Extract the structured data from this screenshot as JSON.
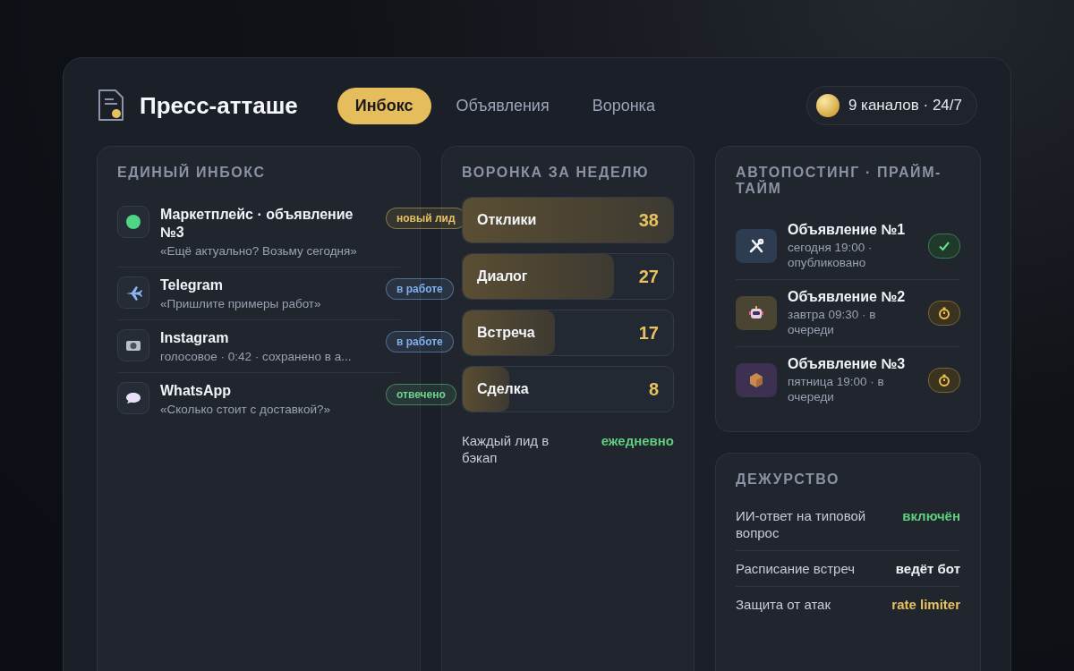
{
  "brand": {
    "title": "Пресс-атташе"
  },
  "tabs": [
    {
      "label": "Инбокс",
      "selected": true
    },
    {
      "label": "Объявления",
      "selected": false
    },
    {
      "label": "Воронка",
      "selected": false
    }
  ],
  "channels_pill": {
    "label": "9 каналов · 24/7"
  },
  "inbox": {
    "title": "ЕДИНЫЙ ИНБОКС",
    "items": [
      {
        "kind": "dot",
        "name": "Маркетплейс · объявление №3",
        "message": "«Ещё актуально? Возьму сегодня»",
        "badge": "новый лид",
        "color": "#e8c15f"
      },
      {
        "kind": "plane",
        "name": "Telegram",
        "message": "«Пришлите примеры работ»",
        "badge": "в работе",
        "color": "#7fb0ee"
      },
      {
        "kind": "camera",
        "name": "Instagram",
        "message": "голосовое · 0:42 · сохранено в а...",
        "badge": "в работе",
        "color": "#7fb0ee"
      },
      {
        "kind": "bubble",
        "name": "WhatsApp",
        "message": "«Сколько стоит с доставкой?»",
        "badge": "отвечено",
        "color": "#6fd58c"
      }
    ]
  },
  "funnel": {
    "title": "ВОРОНКА ЗА НЕДЕЛЮ",
    "bars": [
      {
        "label": "Отклики",
        "value": "38",
        "level": 1
      },
      {
        "label": "Диалог",
        "value": "27",
        "level": 0.72
      },
      {
        "label": "Встреча",
        "value": "17",
        "level": 0.44
      },
      {
        "label": "Сделка",
        "value": "8",
        "level": 0.22
      }
    ],
    "backup": {
      "label": "Каждый лид в бэкап",
      "value": "ежедневно"
    }
  },
  "autopost": {
    "title": "АВТОПОСТИНГ · ПРАЙМ-ТАЙМ",
    "items": [
      {
        "kind": "tools",
        "title": "Объявление №1",
        "subtitle": "сегодня 19:00 · опубликовано",
        "published": true
      },
      {
        "kind": "robot",
        "title": "Объявление №2",
        "subtitle": "завтра 09:30 · в очереди",
        "published": false
      },
      {
        "kind": "box",
        "title": "Объявление №3",
        "subtitle": "пятница 19:00 · в очереди",
        "published": false
      }
    ]
  },
  "duty": {
    "title": "ДЕЖУРСТВО",
    "rows": [
      {
        "label": "ИИ-ответ на типовой вопрос",
        "value": "включён",
        "color": "#5fce7e"
      },
      {
        "label": "Расписание встреч",
        "value": "ведёт бот",
        "color": "#f2f4f8"
      },
      {
        "label": "Защита от атак",
        "value": "rate limiter",
        "color": "#e8c15f"
      }
    ]
  }
}
